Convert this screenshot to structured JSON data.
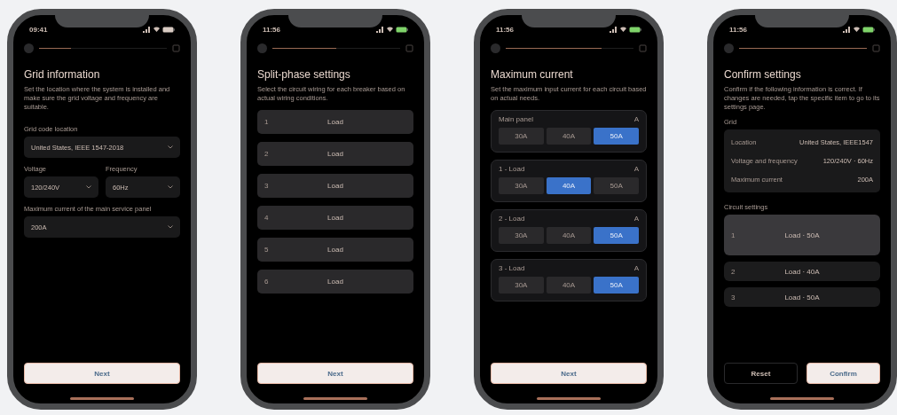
{
  "screens": [
    {
      "kind": "grid",
      "time": "09:41",
      "charging": false,
      "progress": {
        "level": 0.25
      },
      "title": "Grid information",
      "description": "Set the location where the system is installed and make sure the grid voltage and frequency are suitable.",
      "fields": [
        {
          "kind": "wide",
          "label": "Grid code location",
          "value": "United States, IEEE 1547-2018"
        },
        {
          "kind": "half",
          "label": "Voltage",
          "value": "120/240V"
        },
        {
          "kind": "half",
          "label": "Frequency",
          "value": "60Hz"
        },
        {
          "kind": "wide",
          "label": "Maximum current of the main service panel",
          "value": "200A"
        }
      ],
      "buttons": [
        {
          "kind": "primary",
          "label": "Next"
        }
      ]
    },
    {
      "kind": "split",
      "time": "11:56",
      "charging": true,
      "progress": {
        "level": 0.5
      },
      "title": "Split-phase settings",
      "description": "Select the circuit wiring for each breaker based on actual wiring conditions.",
      "rows": [
        {
          "index": "1",
          "label": "Load"
        },
        {
          "index": "2",
          "label": "Load"
        },
        {
          "index": "3",
          "label": "Load"
        },
        {
          "index": "4",
          "label": "Load"
        },
        {
          "index": "5",
          "label": "Load"
        },
        {
          "index": "6",
          "label": "Load"
        }
      ],
      "buttons": [
        {
          "kind": "primary",
          "label": "Next"
        }
      ]
    },
    {
      "kind": "current",
      "time": "11:56",
      "charging": true,
      "progress": {
        "level": 0.75
      },
      "title": "Maximum current",
      "description": "Set the maximum input current for each circuit based on actual needs.",
      "cards": [
        {
          "label": "Main panel",
          "hint": "A",
          "options": [
            {
              "label": "30A",
              "selected": false
            },
            {
              "label": "40A",
              "selected": false
            },
            {
              "label": "50A",
              "selected": true
            }
          ]
        },
        {
          "label": "1 - Load",
          "hint": "A",
          "options": [
            {
              "label": "30A",
              "selected": false
            },
            {
              "label": "40A",
              "selected": true
            },
            {
              "label": "50A",
              "selected": false
            }
          ]
        },
        {
          "label": "2 - Load",
          "hint": "A",
          "options": [
            {
              "label": "30A",
              "selected": false
            },
            {
              "label": "40A",
              "selected": false
            },
            {
              "label": "50A",
              "selected": true
            }
          ]
        },
        {
          "label": "3 - Load",
          "hint": "A",
          "options": [
            {
              "label": "30A",
              "selected": false
            },
            {
              "label": "40A",
              "selected": false
            },
            {
              "label": "50A",
              "selected": true
            }
          ]
        }
      ],
      "buttons": [
        {
          "kind": "primary",
          "label": "Next"
        }
      ]
    },
    {
      "kind": "confirm",
      "time": "11:56",
      "charging": true,
      "progress": {
        "level": 1
      },
      "title": "Confirm settings",
      "description": "Confirm if the following information is correct. If changes are needed, tap the specific item to go to its settings page.",
      "grid_heading": "Grid",
      "summary": [
        {
          "label": "Location",
          "value": "United States, IEEE1547"
        },
        {
          "label": "Voltage and frequency",
          "value": "120/240V · 60Hz"
        },
        {
          "label": "Maximum current",
          "value": "200A"
        }
      ],
      "circuits_heading": "Circuit settings",
      "circuits": [
        {
          "index": "1",
          "text": "Load · 50A",
          "selected": true
        },
        {
          "index": "2",
          "text": "Load · 40A",
          "selected": false
        },
        {
          "index": "3",
          "text": "Load · 50A",
          "selected": false
        }
      ],
      "buttons": [
        {
          "kind": "secondary",
          "label": "Reset"
        },
        {
          "kind": "primary",
          "label": "Confirm"
        }
      ]
    }
  ]
}
